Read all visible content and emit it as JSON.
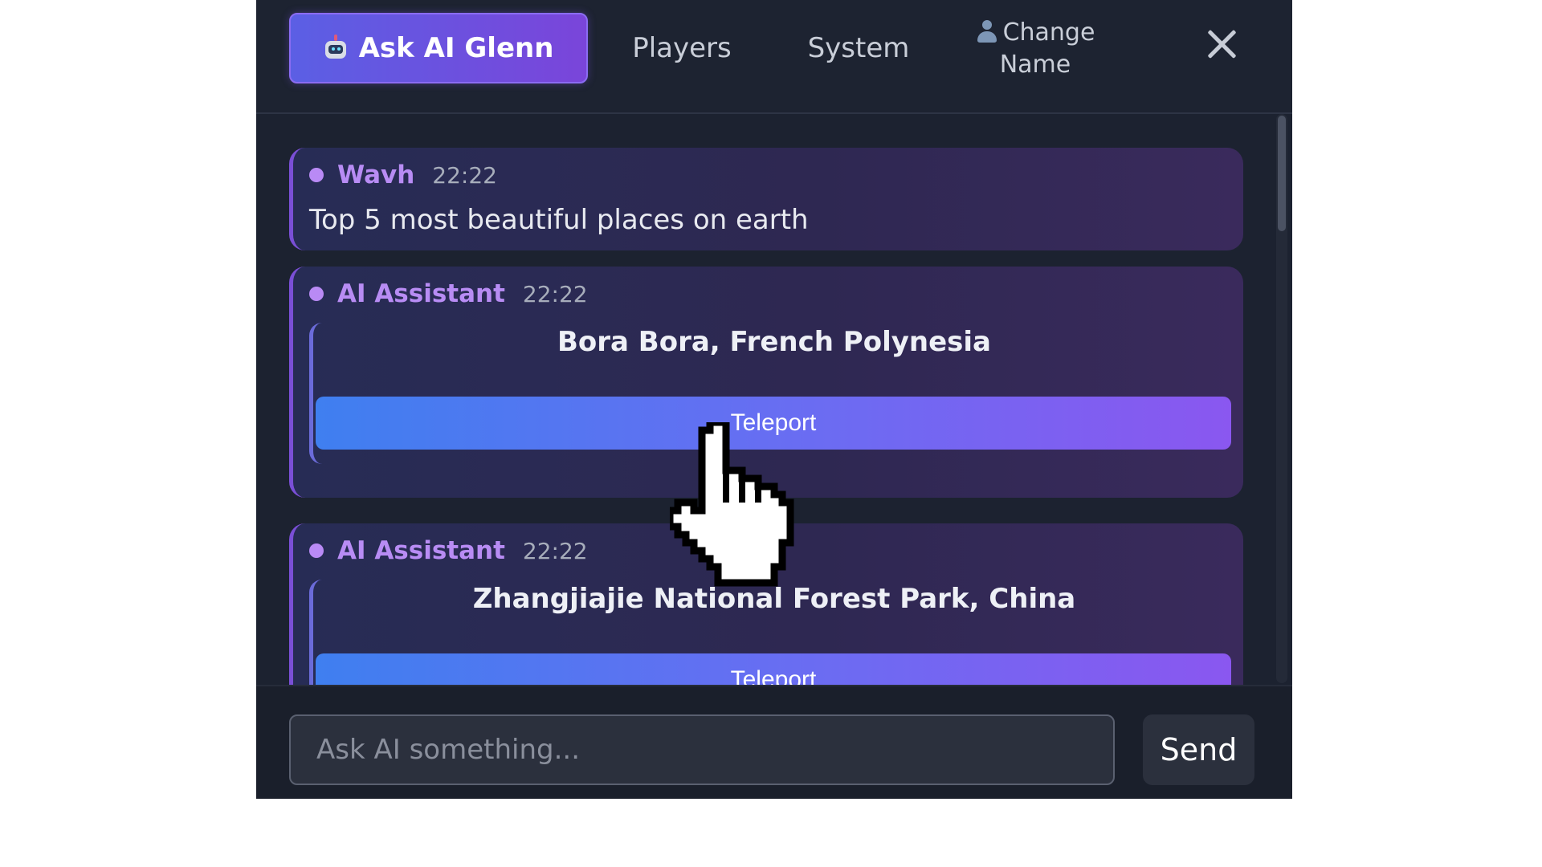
{
  "header": {
    "tabs": [
      {
        "label": "Ask AI Glenn",
        "icon": "robot-icon",
        "active": true
      },
      {
        "label": "Players",
        "active": false
      },
      {
        "label": "System",
        "active": false
      }
    ],
    "change_name": {
      "line1": "Change",
      "line2": "Name",
      "icon": "user-icon"
    },
    "close_icon": "close-icon"
  },
  "messages": [
    {
      "author": "Wavh",
      "time": "22:22",
      "text": "Top 5 most beautiful places on earth"
    },
    {
      "author": "AI Assistant",
      "time": "22:22",
      "place": "Bora Bora, French Polynesia",
      "button": "Teleport"
    },
    {
      "author": "AI Assistant",
      "time": "22:22",
      "place": "Zhangjiajie National Forest Park, China",
      "button": "Teleport"
    }
  ],
  "footer": {
    "placeholder": "Ask AI something...",
    "value": "",
    "send_label": "Send"
  },
  "colors": {
    "accent_purple": "#8b6cf2",
    "author_purple": "#b88cf4",
    "panel_bg": "#1c2230",
    "teleport_start": "#3f7ff0",
    "teleport_end": "#8a57f0"
  }
}
